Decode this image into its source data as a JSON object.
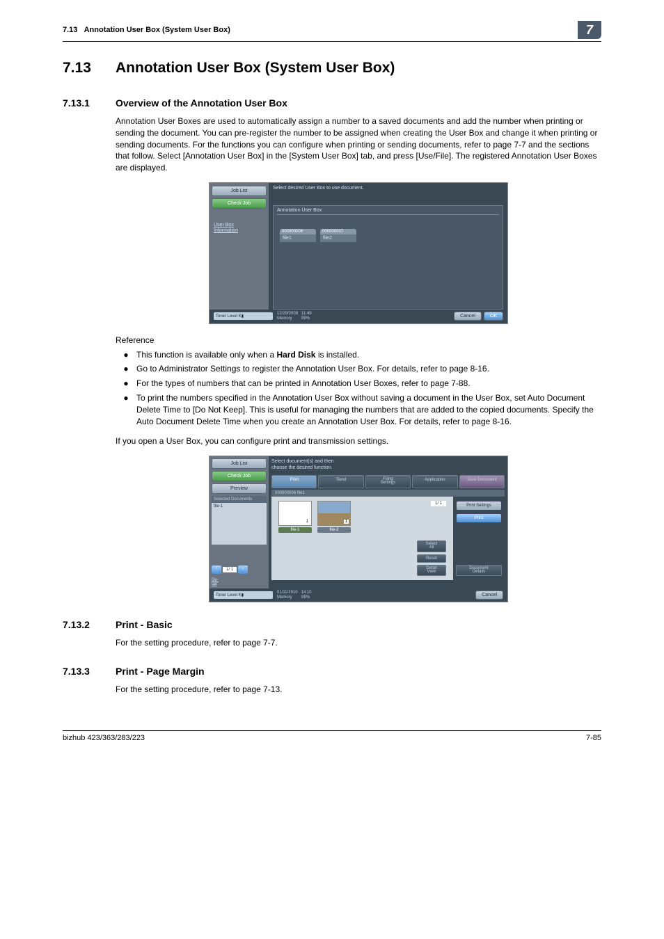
{
  "header": {
    "section_ref": "7.13",
    "section_title": "Annotation User Box (System User Box)",
    "chapter_badge": "7"
  },
  "h1": {
    "num": "7.13",
    "title": "Annotation User Box (System User Box)"
  },
  "sec1": {
    "num": "7.13.1",
    "title": "Overview of the Annotation User Box",
    "para": "Annotation User Boxes are used to automatically assign a number to a saved documents and add the number when printing or sending the document. You can pre-register the number to be assigned when creating the User Box and change it when printing or sending documents. For the functions you can configure when printing or sending documents, refer to page 7-7 and the sections that follow. Select [Annotation User Box] in the [System User Box] tab, and press [Use/File]. The registered Annotation User Boxes are displayed.",
    "reference_label": "Reference",
    "bullets": {
      "b1_pre": "This function is available only when a ",
      "b1_bold": "Hard Disk",
      "b1_post": " is installed.",
      "b2": "Go to Administrator Settings to register the Annotation User Box. For details, refer to page 8-16.",
      "b3": "For the types of numbers that can be printed in Annotation User Boxes, refer to page 7-88.",
      "b4": "To print the numbers specified in the Annotation User Box without saving a document in the User Box, set Auto Document Delete Time to [Do Not Keep]. This is useful for managing the numbers that are added to the copied documents. Specify the Auto Document Delete Time when you create an Annotation User Box. For details, refer to page 8-16."
    },
    "para2": "If you open a User Box, you can configure print and transmission settings."
  },
  "shot1": {
    "job_list": "Job List",
    "check_job": "Check Job",
    "userbox_info": "User Box\nInformation",
    "instruction": "Select desired User Box to use document.",
    "panel_title": "Annotation User Box",
    "folder1_id": "000000006",
    "folder1_name": "file1",
    "folder2_id": "000000007",
    "folder2_name": "file2",
    "toner": "Toner Level  K▮",
    "date": "12/29/2009",
    "time": "11:49",
    "memory": "Memory",
    "memory_val": "99%",
    "cancel": "Cancel",
    "ok": "OK"
  },
  "shot2": {
    "job_list": "Job List",
    "check_job": "Check Job",
    "preview": "Preview",
    "selected_docs": "Selected Documents",
    "selected_item": "file-1",
    "detail_link": "De-\ntail",
    "instruction": "Select document(s) and then\nchoose the desired function.",
    "tab_print": "Print",
    "tab_send": "Send",
    "tab_filing": "Filing\nSettings",
    "tab_app": "Application",
    "tab_save": "Save Document",
    "subhead": "000000006  file1",
    "thumb1": "file-1",
    "thumb2": "file-2",
    "pager": "1/  1",
    "print_settings": "Print Settings",
    "print": "Print",
    "select_all": "Select\nAll",
    "reset": "Reset",
    "detail_view": "Detail\nView",
    "doc_details": "Document\nDetails",
    "page_small": "1/  1",
    "toner": "Toner Level  K▮",
    "date": "01/11/2010",
    "time": "14:10",
    "memory": "Memory",
    "memory_val": "99%",
    "cancel": "Cancel"
  },
  "sec2": {
    "num": "7.13.2",
    "title": "Print - Basic",
    "body": "For the setting procedure, refer to page 7-7."
  },
  "sec3": {
    "num": "7.13.3",
    "title": "Print - Page Margin",
    "body": "For the setting procedure, refer to page 7-13."
  },
  "footer": {
    "left": "bizhub 423/363/283/223",
    "right": "7-85"
  }
}
